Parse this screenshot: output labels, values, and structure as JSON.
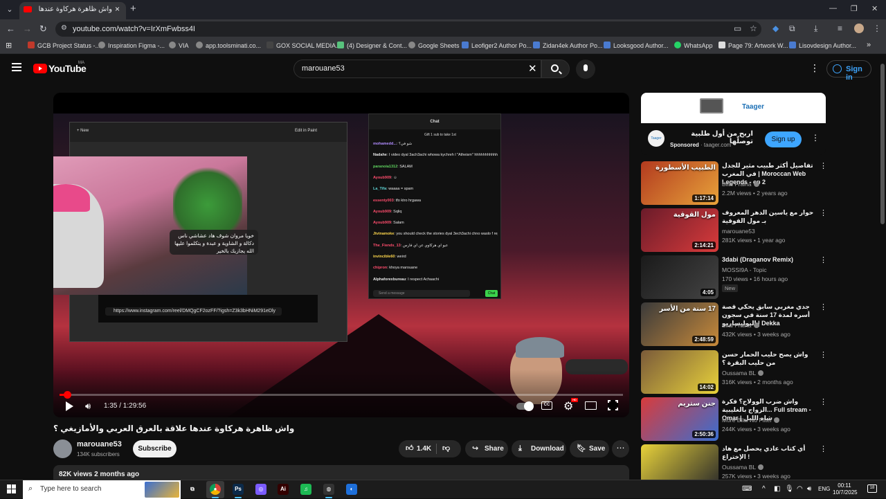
{
  "browser": {
    "tab_title": "واش ظاهرة هركاوة عندها علاقة",
    "tab_close": "×",
    "new_tab": "+",
    "url": "youtube.com/watch?v=IrXmFwbss4I",
    "bookmarks": [
      {
        "label": "GCB Project Status -...",
        "color": "#c0392b"
      },
      {
        "label": "Inspiration Figma -...",
        "color": "#888888"
      },
      {
        "label": "VIA",
        "color": "#888888"
      },
      {
        "label": "app.toolsminati.co...",
        "color": "#888888"
      },
      {
        "label": "GOX SOCIAL MEDIA...",
        "color": "#444444"
      },
      {
        "label": "(4) Designer & Cont...",
        "color": "#58c27d"
      },
      {
        "label": "Google Sheets",
        "color": "#888888"
      },
      {
        "label": "Leofiger2 Author Po...",
        "color": "#4a7bd0"
      },
      {
        "label": "Zidan4ek Author Po...",
        "color": "#4a7bd0"
      },
      {
        "label": "Looksgood Author...",
        "color": "#4a7bd0"
      },
      {
        "label": "WhatsApp",
        "color": "#25d366"
      },
      {
        "label": "Page 79: Artwork W...",
        "color": "#dddddd"
      },
      {
        "label": "Lisovdesign Author...",
        "color": "#4a7bd0"
      }
    ]
  },
  "youtube": {
    "wordmark": "YouTube",
    "region": "MA",
    "search_value": "marouane53",
    "sign_in": "Sign in"
  },
  "player": {
    "time": "1:35 / 1:29:56",
    "progress_fraction": 0.018,
    "cc_label": "CC",
    "hd_label": "HD",
    "stream": {
      "snip_new": "+ New",
      "snip_edit": "Edit in Paint",
      "chat_header": "Chat",
      "chat_gift": "Gift 1 sub to take 1st",
      "chat_messages": [
        {
          "user": "mohamedd...",
          "text": ": شو في؟",
          "color": "#b18cff"
        },
        {
          "user": "Nadahe",
          "text": ": I video dyal 3ach3achi whowa kychreh l \"Atheism\" hhhhhhhhhhhhhhhhhhhh",
          "color": "#e8e8e8"
        },
        {
          "user": "paranoia1312",
          "text": ": SALAM",
          "color": "#5fd35f"
        },
        {
          "user": "Ayoub909",
          "text": ": ☺",
          "color": "#ff4d6d"
        },
        {
          "user": "La_Tifa",
          "text": ": waaaa = spam",
          "color": "#5fd3d3"
        },
        {
          "user": "essenty003",
          "text": ": tfo ktro hrgawa",
          "color": "#ff4d6d"
        },
        {
          "user": "Ayoub909",
          "text": ": Sqliq",
          "color": "#ff4d6d"
        },
        {
          "user": "Ayoub909",
          "text": ": Salam",
          "color": "#ff4d6d"
        },
        {
          "user": "Jtvinamoke",
          "text": ": you should check the stories dyal 3ech3achi chno waslo f replies dm",
          "color": "#ffd84d"
        },
        {
          "user": "The_Fiends_13",
          "text": ": عبو اي هركاوي عن اي فارس",
          "color": "#ff4d6d"
        },
        {
          "user": "invincible60",
          "text": ": weird",
          "color": "#ffd84d"
        },
        {
          "user": "chipron",
          "text": ": khoya marouane",
          "color": "#ff4d6d"
        },
        {
          "user": "Alphaforexbureau",
          "text": ": I respect Achaachi",
          "color": "#e8e8e8"
        }
      ],
      "chat_input_placeholder": "Send a message",
      "chat_send": "Chat",
      "ig_url": "https://www.instagram.com/reel/DMQgCF2ozFF/?igsh=Z3k3bHNiM291eDly",
      "overlay_text": "خويا مروان شوف هاد عشاشي ناس دكالة و الشاوية و عبدة و يتكلموا عليها الله يجازيك بالخير"
    }
  },
  "video": {
    "title": "واش ظاهرة هركاوة عندها علاقة بالعرق العربي والأمازيغي ؟",
    "channel": "marouane53",
    "subscribers": "134K subscribers",
    "subscribe_label": "Subscribe",
    "likes": "1.4K",
    "share_label": "Share",
    "download_label": "Download",
    "save_label": "Save",
    "views_date": "82K views  2 months ago"
  },
  "sidebar": {
    "ad": {
      "brand": "Taager",
      "headline": "اربح من أول طلبية توصلّها",
      "sponsored": "Sponsored",
      "domain": "taager.com",
      "cta": "Sign up"
    },
    "recommendations": [
      {
        "title": "تفاصيل أكثر طبيب مثير للجدل في المغرب | Moroccan Web Legends - ep 2",
        "channel": "Bilal Fraiha",
        "meta": "2.2M views • 2 years ago",
        "duration": "1:17:14",
        "verified": true,
        "new": false,
        "thumb": [
          "#b23a1f",
          "#e8a33a"
        ],
        "thumb_text": "الطبيب الأسطورة"
      },
      {
        "title": "حوار مع ياسين الدهر المعروف بـ مول القوقية",
        "channel": "marouane53",
        "meta": "281K views • 1 year ago",
        "duration": "2:14:21",
        "verified": false,
        "new": false,
        "thumb": [
          "#6a1b2a",
          "#d93b3b"
        ],
        "thumb_text": "مول القوقية"
      },
      {
        "title": "3dabi (Draganov Remix)",
        "channel": "MOSSI9A - Topic",
        "meta": "170 views • 16 hours ago",
        "duration": "4:05",
        "verified": false,
        "new": true,
        "thumb": [
          "#1a1a1a",
          "#444444"
        ],
        "thumb_text": ""
      },
      {
        "title": "جدي مغربي سابق يحكي قصة أسره لمدة 17 سنة في سجون البوليساريو | Dekka",
        "channel": "Bilal Fraiha",
        "meta": "432K views • 3 weeks ago",
        "duration": "2:48:59",
        "verified": true,
        "new": false,
        "thumb": [
          "#3a3a3a",
          "#c88a3a"
        ],
        "thumb_text": "17 سنة من الأسر"
      },
      {
        "title": "واش يصح حليب الحمار حسن من حليب البقرة ؟",
        "channel": "Oussama BL",
        "meta": "316K views • 2 months ago",
        "duration": "14:02",
        "verified": true,
        "new": false,
        "thumb": [
          "#7a5a3a",
          "#e8d23a"
        ],
        "thumb_text": ""
      },
      {
        "title": "واش ضرب الوولاج؟ فكرة الزواج بالغليبية... Full stream - Omar | شاه الليل",
        "channel": "More Bilal No Filter",
        "meta": "244K views • 3 weeks ago",
        "duration": "2:50:36",
        "verified": true,
        "new": false,
        "thumb": [
          "#d93b3b",
          "#3a6ed0"
        ],
        "thumb_text": "جنن ستريم"
      },
      {
        "title": "أي كتاب عادي يحصل مع هاد الإختراع !",
        "channel": "Oussama BL",
        "meta": "257K views • 3 weeks ago",
        "duration": "",
        "verified": true,
        "new": false,
        "thumb": [
          "#e8d23a",
          "#2a2a2a"
        ],
        "thumb_text": ""
      }
    ]
  },
  "taskbar": {
    "search_placeholder": "Type here to search",
    "apps": [
      {
        "name": "task-view",
        "label": "⧉",
        "color": "transparent"
      },
      {
        "name": "chrome",
        "label": "●",
        "color": "#e8a33a"
      },
      {
        "name": "photoshop",
        "label": "Ps",
        "color": "#0b2a4a"
      },
      {
        "name": "app-purple",
        "label": "◎",
        "color": "#7b5cff"
      },
      {
        "name": "illustrator",
        "label": "Ai",
        "color": "#330000"
      },
      {
        "name": "spotify",
        "label": "♫",
        "color": "#1db954"
      },
      {
        "name": "app-dark",
        "label": "◍",
        "color": "#333333"
      },
      {
        "name": "app-blue",
        "label": "◐",
        "color": "#1e6fd9"
      }
    ],
    "language": "ENG",
    "time": "00:11",
    "date": "10/7/2025",
    "notifications": "18"
  },
  "colors": {
    "accent_red": "#ff0000",
    "link_blue": "#3ea6ff",
    "bg": "#0f0f0f"
  }
}
